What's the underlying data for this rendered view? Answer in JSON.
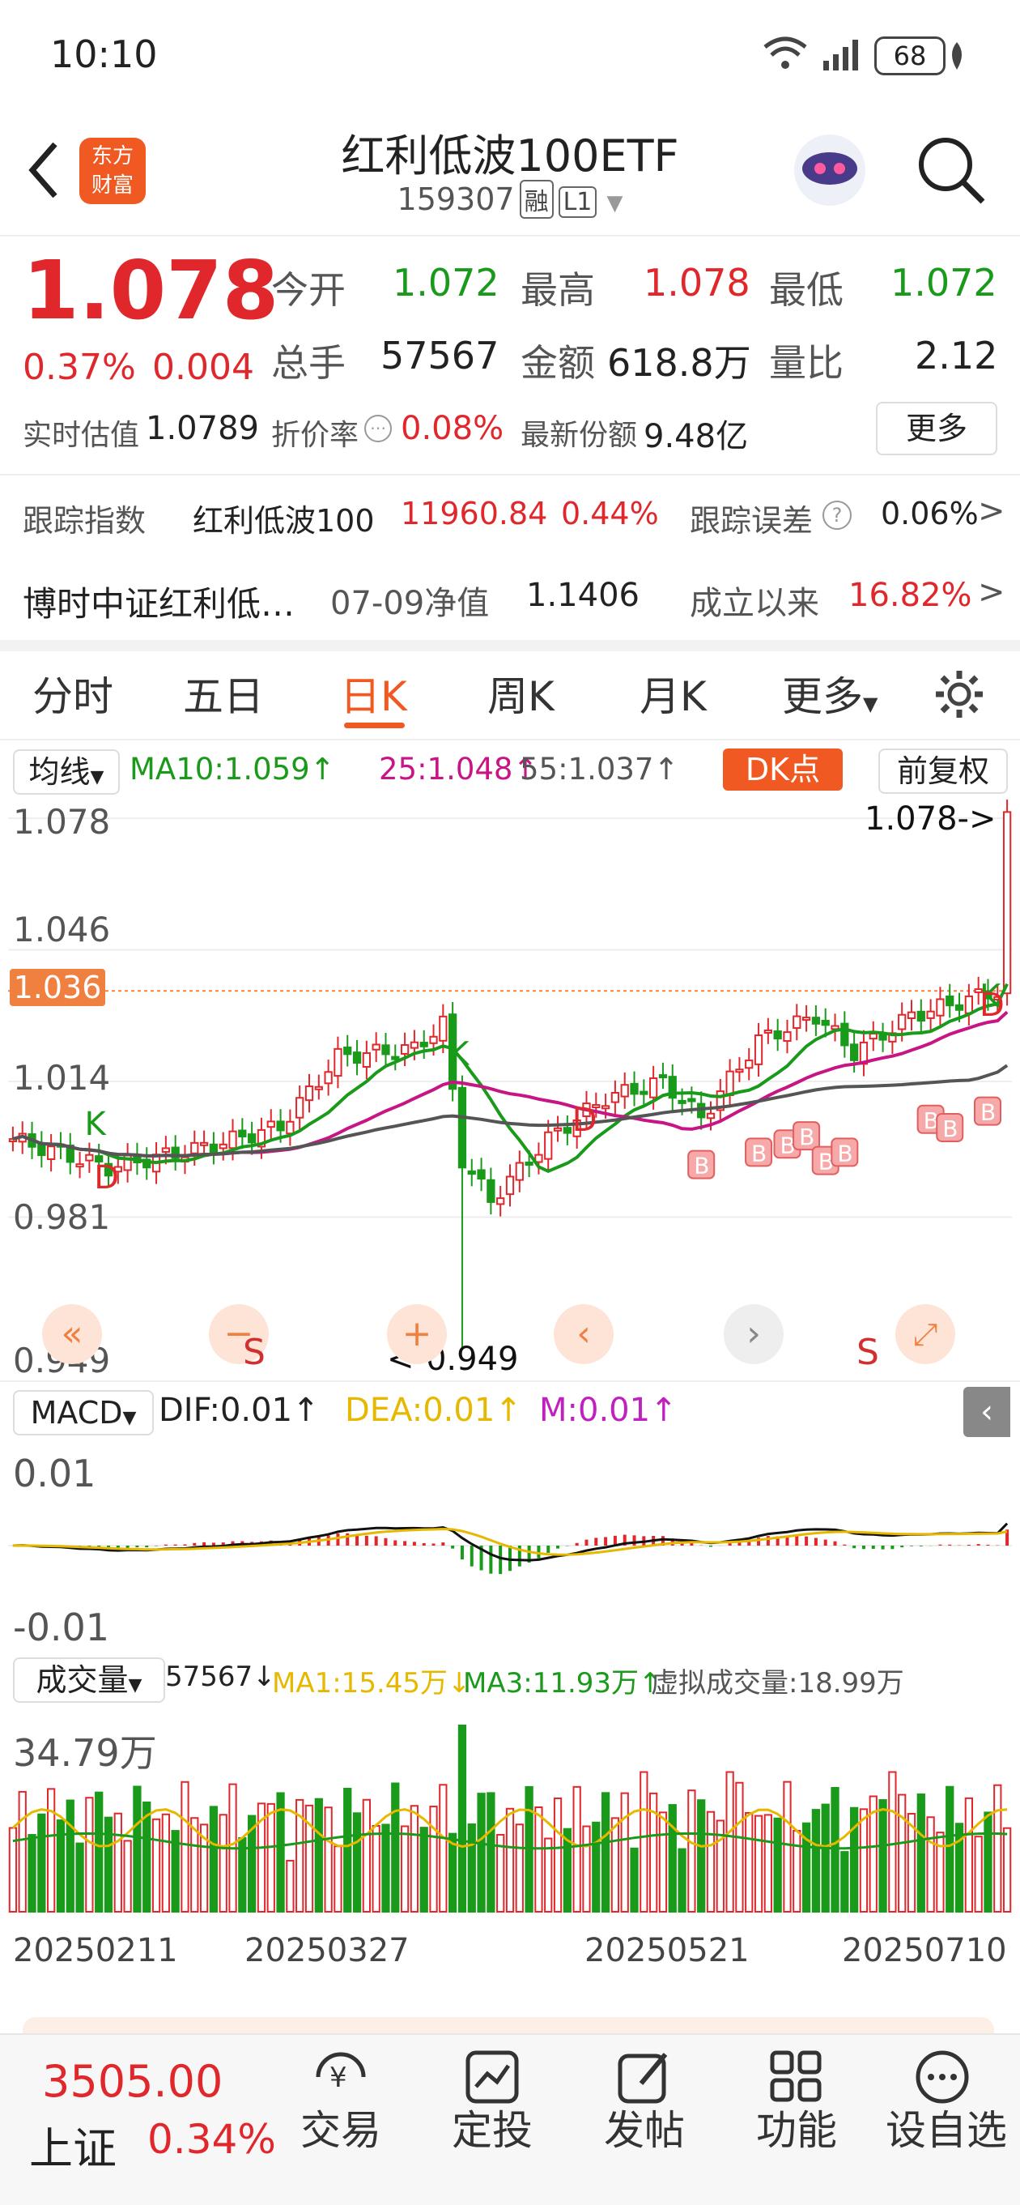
{
  "status_bar": {
    "time": "10:10",
    "battery": "68"
  },
  "header": {
    "title": "红利低波100ETF",
    "code": "159307",
    "tag_margin": "融",
    "tag_level": "L1",
    "logo_line1": "东方",
    "logo_line2": "财富"
  },
  "quote": {
    "price": "1.078",
    "change_pct": "0.37%",
    "change_abs": "0.004",
    "open_label": "今开",
    "open_value": "1.072",
    "high_label": "最高",
    "high_value": "1.078",
    "low_label": "最低",
    "low_value": "1.072",
    "volume_label": "总手",
    "volume_value": "57567",
    "amount_label": "金额",
    "amount_value": "618.8万",
    "ratio_label": "量比",
    "ratio_value": "2.12",
    "iopv_label": "实时估值",
    "iopv_value": "1.0789",
    "discount_label": "折价率",
    "discount_value": "0.08%",
    "shares_label": "最新份额",
    "shares_value": "9.48亿",
    "more_button": "更多"
  },
  "tracking": {
    "label": "跟踪指数",
    "index_name": "红利低波100",
    "index_value": "11960.84",
    "index_change": "0.44%",
    "error_label": "跟踪误差",
    "error_value": "0.06%"
  },
  "fund": {
    "name": "博时中证红利低…",
    "nav_label": "07-09净值",
    "nav_value": "1.1406",
    "since_label": "成立以来",
    "since_value": "16.82%"
  },
  "chart_tabs": [
    "分时",
    "五日",
    "日K",
    "周K",
    "月K"
  ],
  "chart_tab_more": "更多",
  "active_tab": "日K",
  "ma_bar": {
    "selector": "均线",
    "ma10": "MA10:1.059↑",
    "ma25": "25:1.048↑",
    "ma55": "55:1.037↑",
    "dk_button": "DK点",
    "adjust_button": "前复权"
  },
  "kline": {
    "y_labels": [
      "1.078",
      "1.046",
      "1.014",
      "0.981",
      "0.949"
    ],
    "current_label": "1.036",
    "max_label": "1.078->",
    "min_label": "<-0.949",
    "marker_K": "K",
    "marker_D": "D",
    "marker_B": "B",
    "marker_S": "S"
  },
  "macd": {
    "selector": "MACD",
    "dif": "DIF:0.01↑",
    "dea": "DEA:0.01↑",
    "m": "M:0.01↑",
    "top_label": "0.01",
    "bottom_label": "-0.01"
  },
  "volume": {
    "selector": "成交量",
    "value": "57567↓",
    "ma1": "MA1:15.45万↓",
    "ma3": "MA3:11.93万↑",
    "virtual": "虚拟成交量:18.99万",
    "max_label": "34.79万"
  },
  "x_dates": [
    "20250211",
    "20250327",
    "20250521",
    "20250710"
  ],
  "index_bar": {
    "value": "3505.00",
    "name": "上证",
    "change": "0.34%"
  },
  "bottom_nav": [
    "交易",
    "定投",
    "发帖",
    "功能",
    "设自选"
  ],
  "colors": {
    "up": "#e0272c",
    "down": "#1a9a1a",
    "accent": "#f05a22",
    "ma10": "#1a9a1a",
    "ma25": "#c71585",
    "ma55": "#555555",
    "dea": "#e6b800"
  }
}
